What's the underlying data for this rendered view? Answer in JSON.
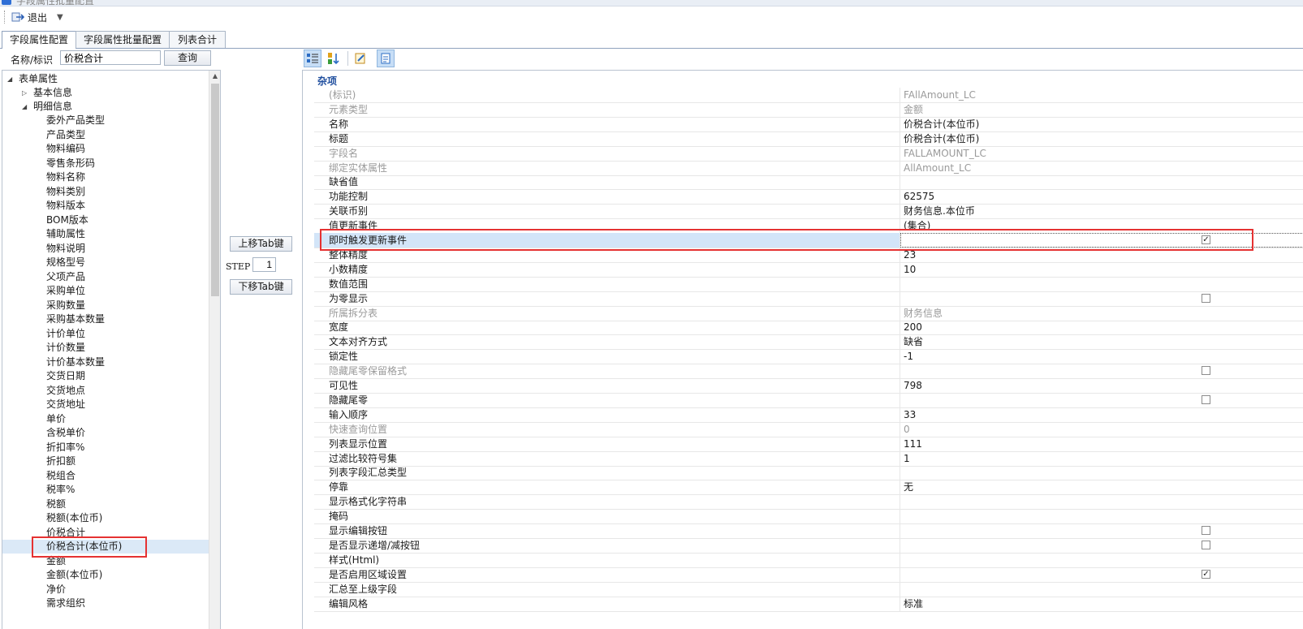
{
  "window": {
    "title": "字段属性批量配置"
  },
  "toolbar": {
    "exit_label": "退出"
  },
  "tabs": [
    {
      "label": "字段属性配置",
      "active": true
    },
    {
      "label": "字段属性批量配置",
      "active": false
    },
    {
      "label": "列表合计",
      "active": false
    }
  ],
  "search": {
    "label": "名称/标识",
    "value": "价税合计",
    "button": "查询"
  },
  "tree": {
    "root": "表单属性",
    "basic": "基本信息",
    "detail": "明细信息",
    "items": [
      "委外产品类型",
      "产品类型",
      "物料编码",
      "零售条形码",
      "物料名称",
      "物料类别",
      "物料版本",
      "BOM版本",
      "辅助属性",
      "物料说明",
      "规格型号",
      "父项产品",
      "采购单位",
      "采购数量",
      "采购基本数量",
      "计价单位",
      "计价数量",
      "计价基本数量",
      "交货日期",
      "交货地点",
      "交货地址",
      "单价",
      "含税单价",
      "折扣率%",
      "折扣额",
      "税组合",
      "税率%",
      "税额",
      "税额(本位币)",
      "价税合计",
      "价税合计(本位币)",
      "金额",
      "金额(本位币)",
      "净价",
      "需求组织"
    ],
    "selected_index": 30
  },
  "middle": {
    "up_button": "上移Tab键",
    "step_label": "STEP",
    "step_value": "1",
    "down_button": "下移Tab键"
  },
  "props": {
    "category": "杂项",
    "rows": [
      {
        "name": "(标识)",
        "value": "FAllAmount_LC",
        "ro": true
      },
      {
        "name": "元素类型",
        "value": "金额",
        "ro": true
      },
      {
        "name": "名称",
        "value": "价税合计(本位币)"
      },
      {
        "name": "标题",
        "value": "价税合计(本位币)"
      },
      {
        "name": "字段名",
        "value": "FALLAMOUNT_LC",
        "ro": true
      },
      {
        "name": "绑定实体属性",
        "value": "AllAmount_LC",
        "ro": true
      },
      {
        "name": "缺省值",
        "value": ""
      },
      {
        "name": "功能控制",
        "value": "62575"
      },
      {
        "name": "关联币别",
        "value": "财务信息.本位币"
      },
      {
        "name": "值更新事件",
        "value": "(集合)"
      },
      {
        "name": "即时触发更新事件",
        "value": "",
        "checkbox": true,
        "checked": true,
        "selected": true
      },
      {
        "name": "整体精度",
        "value": "23"
      },
      {
        "name": "小数精度",
        "value": "10"
      },
      {
        "name": "数值范围",
        "value": ""
      },
      {
        "name": "为零显示",
        "value": "",
        "checkbox": true,
        "checked": false
      },
      {
        "name": "所属拆分表",
        "value": "财务信息",
        "ro": true
      },
      {
        "name": "宽度",
        "value": "200"
      },
      {
        "name": "文本对齐方式",
        "value": "缺省"
      },
      {
        "name": "锁定性",
        "value": "-1"
      },
      {
        "name": "隐藏尾零保留格式",
        "value": "",
        "checkbox": true,
        "checked": false,
        "ro": true
      },
      {
        "name": "可见性",
        "value": "798"
      },
      {
        "name": "隐藏尾零",
        "value": "",
        "checkbox": true,
        "checked": false
      },
      {
        "name": "输入顺序",
        "value": "33"
      },
      {
        "name": "快速查询位置",
        "value": "0",
        "ro": true
      },
      {
        "name": "列表显示位置",
        "value": "111"
      },
      {
        "name": "过滤比较符号集",
        "value": "1"
      },
      {
        "name": "列表字段汇总类型",
        "value": ""
      },
      {
        "name": "停靠",
        "value": "无"
      },
      {
        "name": "显示格式化字符串",
        "value": ""
      },
      {
        "name": "掩码",
        "value": ""
      },
      {
        "name": "显示编辑按钮",
        "value": "",
        "checkbox": true,
        "checked": false
      },
      {
        "name": "是否显示递增/减按钮",
        "value": "",
        "checkbox": true,
        "checked": false
      },
      {
        "name": "样式(Html)",
        "value": ""
      },
      {
        "name": "是否启用区域设置",
        "value": "",
        "checkbox": true,
        "checked": true
      },
      {
        "name": "汇总至上级字段",
        "value": ""
      },
      {
        "name": "编辑风格",
        "value": "标准"
      }
    ]
  }
}
